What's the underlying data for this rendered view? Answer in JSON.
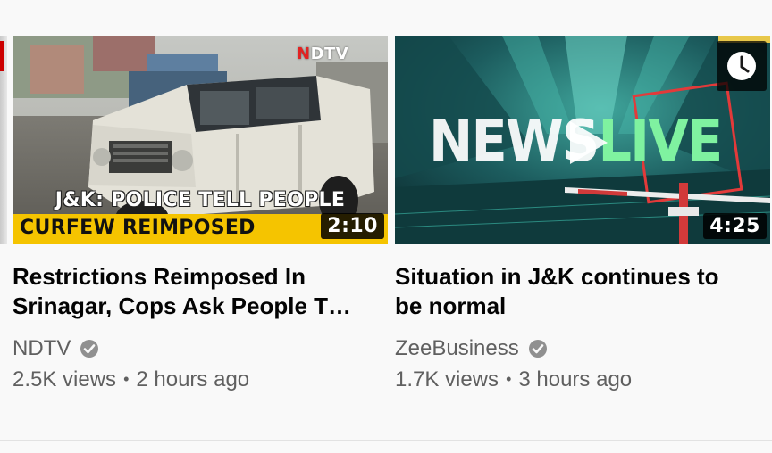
{
  "colors": {
    "title_text": "#030303",
    "meta_text": "#606060",
    "background": "#f9f9f9",
    "duration_badge": "#000000",
    "overlay_yellow": "#f5c400"
  },
  "videos": [
    {
      "title": "Restrictions Reimposed In Srinagar, Cops Ask People T…",
      "channel": "NDTV",
      "verified_icon": "verified-check-icon",
      "views": "2.5K views",
      "separator": "•",
      "age": "2 hours ago",
      "duration": "2:10",
      "thumbnail": {
        "logo_prefix": "N",
        "logo_rest": "DTV",
        "caption_line1": "J&K: POLICE TELL PEOPLE",
        "caption_line2": "CURFEW REIMPOSED"
      }
    },
    {
      "title": "Situation in J&K continues to be normal",
      "channel": "ZeeBusiness",
      "verified_icon": "verified-check-icon",
      "views": "1.7K views",
      "separator": "•",
      "age": "3 hours ago",
      "duration": "4:25",
      "thumbnail": {
        "word1": "NEWS",
        "word2": "LIVE",
        "watch_later_icon": "clock-icon",
        "play_icon": "play-icon"
      }
    }
  ]
}
